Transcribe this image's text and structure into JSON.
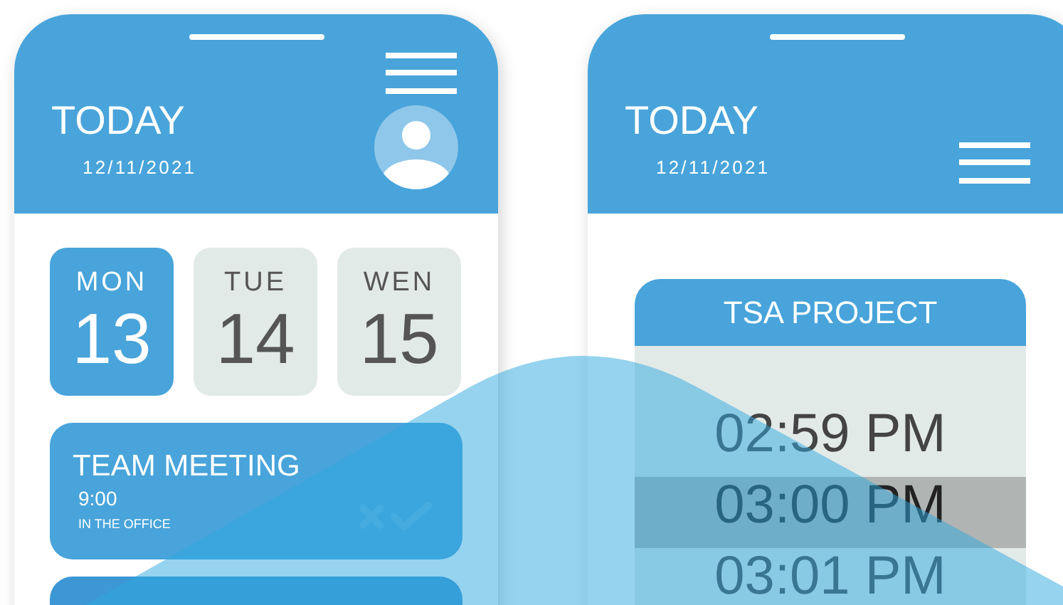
{
  "phones": [
    {
      "title": "TODAY",
      "date": "12/11/2021",
      "avatar": true,
      "days": [
        {
          "weekday": "MON",
          "day": "13",
          "selected": true
        },
        {
          "weekday": "TUE",
          "day": "14",
          "selected": false
        },
        {
          "weekday": "WEN",
          "day": "15",
          "selected": false
        }
      ],
      "events": [
        {
          "title": "TEAM MEETING",
          "time": "9:00",
          "location": "IN THE OFFICE"
        }
      ]
    },
    {
      "title": "TODAY",
      "date": "12/11/2021",
      "avatar": false,
      "project": {
        "title": "TSA PROJECT",
        "slots": [
          {
            "time": "02:59 PM",
            "selected": false
          },
          {
            "time": "03:00 PM",
            "selected": true
          },
          {
            "time": "03:01 PM",
            "selected": false
          }
        ]
      }
    }
  ]
}
